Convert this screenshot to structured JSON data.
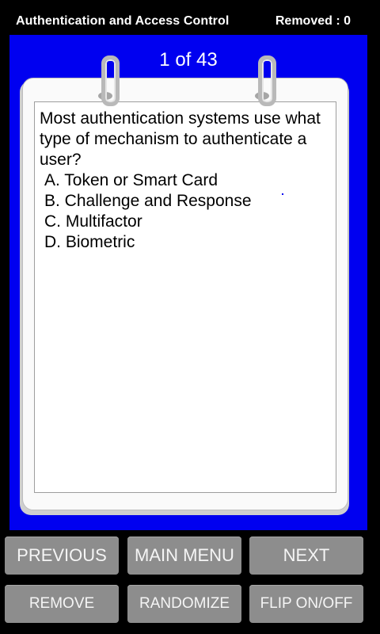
{
  "header": {
    "title": "Authentication and Access Control",
    "removed": "Removed : 0"
  },
  "counter": "1 of 43",
  "question": {
    "text": "Most authentication systems use what type of mechanism to authenticate a user?",
    "answers": [
      "A. Token or Smart Card",
      "B. Challenge and Response",
      "C. Multifactor",
      "D. Biometric"
    ]
  },
  "buttons": {
    "previous": "PREVIOUS",
    "main_menu": "MAIN MENU",
    "next": "NEXT",
    "remove": "REMOVE",
    "randomize": "RANDOMIZE",
    "flip": "FLIP ON/OFF"
  },
  "colors": {
    "stage": "#0000f0",
    "button": "#8d8d8d",
    "header_bg": "#000000"
  }
}
